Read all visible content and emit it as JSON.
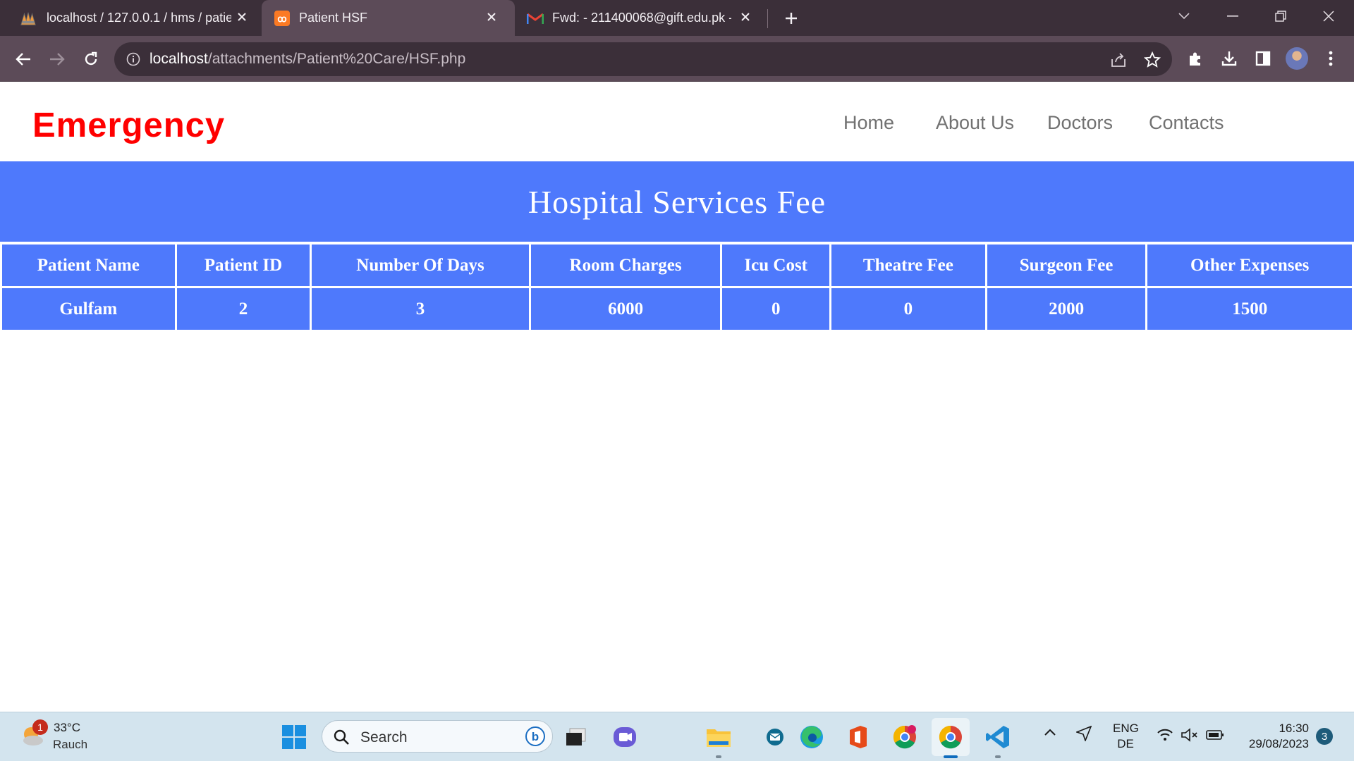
{
  "browser": {
    "tabs": [
      {
        "title": "localhost / 127.0.0.1 / hms / patie",
        "favicon": "phpmyadmin-icon"
      },
      {
        "title": "Patient HSF",
        "favicon": "xampp-icon",
        "active": true
      },
      {
        "title": "Fwd: - 211400068@gift.edu.pk -",
        "favicon": "gmail-icon"
      }
    ],
    "url_host": "localhost",
    "url_path": "/attachments/Patient%20Care/HSF.php"
  },
  "site": {
    "brand": "Emergency",
    "nav": [
      "Home",
      "About Us",
      "Doctors",
      "Contacts"
    ],
    "banner_title": "Hospital Services Fee",
    "table": {
      "headers": [
        "Patient Name",
        "Patient ID",
        "Number Of Days",
        "Room Charges",
        "Icu Cost",
        "Theatre Fee",
        "Surgeon Fee",
        "Other Expenses"
      ],
      "rows": [
        [
          "Gulfam",
          "2",
          "3",
          "6000",
          "0",
          "0",
          "2000",
          "1500"
        ]
      ]
    },
    "colors": {
      "brand": "#ff0000",
      "accent": "#4e79fc",
      "nav_text": "#717171"
    }
  },
  "taskbar": {
    "weather_badge": "1",
    "temperature": "33°C",
    "weather_desc": "Rauch",
    "search_placeholder": "Search",
    "lang_line1": "ENG",
    "lang_line2": "DE",
    "time": "16:30",
    "date": "29/08/2023",
    "notifications": "3"
  }
}
